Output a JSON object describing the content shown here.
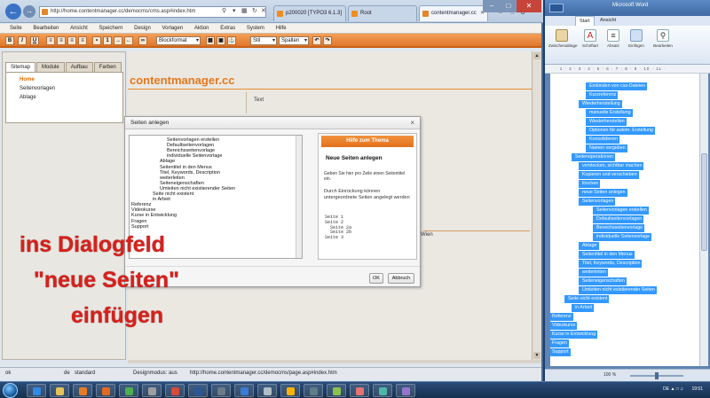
{
  "browser": {
    "url": "http://home.contentmanager.cc/democms/cms.asp#index.htm",
    "tabs": [
      {
        "label": "p200020 [TYPO3 6.1.3]"
      },
      {
        "label": "Root"
      },
      {
        "label": "contentmanager.cc"
      }
    ],
    "menu": [
      "Seite",
      "Bearbeiten",
      "Ansicht",
      "Speichern",
      "Design",
      "Vorlagen",
      "Aktion",
      "Extras",
      "System",
      "Hilfe"
    ],
    "toolbar": {
      "bold": "B",
      "italic": "I",
      "underline": "U",
      "block_format": "Blockformat",
      "style": "Stil",
      "columns": "Spalten"
    }
  },
  "cms": {
    "side_tabs": [
      "Sitemap",
      "Module",
      "Aufbau",
      "Farben"
    ],
    "tree": [
      "Home",
      "Seitenvorlagen",
      "Ablage"
    ],
    "brand": "contentmanager.cc",
    "text_label": "Text",
    "wien": "Wien"
  },
  "dialog": {
    "title": "Seiten anlegen",
    "close": "×",
    "tree_rows": [
      {
        "text": "Seitenvorlagen erstellen",
        "indent": 5
      },
      {
        "text": "Defaultseitenvorlagen",
        "indent": 5
      },
      {
        "text": "Bereichsseitenvorlage",
        "indent": 5
      },
      {
        "text": "individuelle Seitenvorlage",
        "indent": 5
      },
      {
        "text": "Ablage",
        "indent": 4
      },
      {
        "text": "Seitentitel in den Menus",
        "indent": 4
      },
      {
        "text": "Titel, Keywords, Description",
        "indent": 4
      },
      {
        "text": "weiterleiten",
        "indent": 4
      },
      {
        "text": "Seiteneigenschaften",
        "indent": 4
      },
      {
        "text": "Umleiten nicht existierender Seiten",
        "indent": 4
      },
      {
        "text": "Seite nicht existent",
        "indent": 3
      },
      {
        "text": "in Arbeit",
        "indent": 3
      },
      {
        "text": "Referenz",
        "indent": 0
      },
      {
        "text": "Videokurse",
        "indent": 0
      },
      {
        "text": "Kurse in Entwicklung",
        "indent": 0
      },
      {
        "text": "Fragen",
        "indent": 0
      },
      {
        "text": "Support",
        "indent": 0
      }
    ],
    "help": {
      "header": "Hilfe zum Thema",
      "title": "Neue Seiten anlegen",
      "p1": "Geben Sie hier pro Zeile einen Seitentitel ein.",
      "p2": "Durch Einrückung können untergeordnete Seiten angelegt werden",
      "code": "Seite 1\nSeite 2\n  Seite 2a\n  Seite 2b\nSeite 3"
    },
    "ok": "OK",
    "cancel": "Abbruch"
  },
  "caption": {
    "line1": "ins Dialogfeld",
    "line2": "\"neue Seiten\"",
    "line3": "einfügen"
  },
  "status": {
    "ok": "ok",
    "de": "de",
    "standard": "standard",
    "design_mode": "Designmodus: aus",
    "url": "http://home.contentmanager.cc/democms/page.asp#index.htm"
  },
  "word": {
    "title": "Microsoft Word",
    "tabs": [
      "Start",
      "Ansicht"
    ],
    "ribbon": [
      "Zwischenablage",
      "Schriftart",
      "Absatz",
      "Einfügen",
      "Bearbeiten"
    ],
    "zoom": "100 %",
    "lines": [
      {
        "text": "Einbinden von css-Dateien",
        "indent": 5
      },
      {
        "text": "Kurzreferenz",
        "indent": 5
      },
      {
        "text": "Wiederherstellung",
        "indent": 4
      },
      {
        "text": "manuelle Erstellung",
        "indent": 5
      },
      {
        "text": "Wiederherstellen",
        "indent": 5
      },
      {
        "text": "Optionen für autom. Erstellung",
        "indent": 5
      },
      {
        "text": "Konsolidieren",
        "indent": 5
      },
      {
        "text": "Namen vergeben",
        "indent": 5
      },
      {
        "text": "Seitenoperationen",
        "indent": 3
      },
      {
        "text": "verstecken, sichtbar machen",
        "indent": 4
      },
      {
        "text": "Kopieren und verschieben",
        "indent": 4
      },
      {
        "text": "löschen",
        "indent": 4
      },
      {
        "text": "neue Seiten anlegen",
        "indent": 4
      },
      {
        "text": "Seitenvorlagen",
        "indent": 4
      },
      {
        "text": "Seitenvorlagen erstellen",
        "indent": 6
      },
      {
        "text": "Defaultseitenvorlagen",
        "indent": 6
      },
      {
        "text": "Bereichsseitenvorlage",
        "indent": 6
      },
      {
        "text": "individuelle Seitenvorlage",
        "indent": 6
      },
      {
        "text": "Ablage",
        "indent": 4
      },
      {
        "text": "Seitentitel in den Menus",
        "indent": 4
      },
      {
        "text": "Titel, Keywords, Description",
        "indent": 4
      },
      {
        "text": "weiterleiten",
        "indent": 4
      },
      {
        "text": "Seiteneigenschaften",
        "indent": 4
      },
      {
        "text": "Umleiten nicht existierender Seiten",
        "indent": 4
      },
      {
        "text": "Seite nicht existent",
        "indent": 2
      },
      {
        "text": "in Arbeit",
        "indent": 3
      },
      {
        "text": "Referenz",
        "indent": 0
      },
      {
        "text": "Videokurse",
        "indent": 0
      },
      {
        "text": "Kurse in Entwicklung",
        "indent": 0
      },
      {
        "text": "Fragen",
        "indent": 0
      },
      {
        "text": "Support",
        "indent": 0
      }
    ]
  },
  "taskbar": {
    "clock": "19:51",
    "tray": "DE"
  },
  "colors": {
    "accent": "#e4781c",
    "selection": "#3399ff",
    "caption": "#d9201b"
  }
}
